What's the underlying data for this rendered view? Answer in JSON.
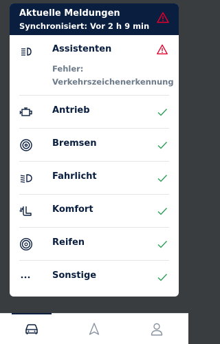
{
  "header": {
    "title": "Aktuelle Meldungen",
    "subtitle": "Synchronisiert: Vor 2 h 9 min",
    "warning_icon": "warning-triangle-icon"
  },
  "items": [
    {
      "label": "Assistenten",
      "icon": "driver-assist-icon",
      "status": "warning",
      "error": [
        "Fehler:",
        "Verkehrszeichenerkennung"
      ]
    },
    {
      "label": "Antrieb",
      "icon": "engine-icon",
      "status": "ok"
    },
    {
      "label": "Bremsen",
      "icon": "brake-icon",
      "status": "ok"
    },
    {
      "label": "Fahrlicht",
      "icon": "headlight-icon",
      "status": "ok"
    },
    {
      "label": "Komfort",
      "icon": "seat-heating-icon",
      "status": "ok"
    },
    {
      "label": "Reifen",
      "icon": "tire-icon",
      "status": "ok"
    },
    {
      "label": "Sonstige",
      "icon": "more-icon",
      "status": "ok"
    }
  ],
  "nav": [
    {
      "name": "car-tab",
      "icon": "car-icon",
      "active": true
    },
    {
      "name": "navigation-tab",
      "icon": "navigation-arrow-icon",
      "active": false
    },
    {
      "name": "profile-tab",
      "icon": "user-icon",
      "active": false
    }
  ],
  "colors": {
    "header_bg": "#0a1e3f",
    "warning": "#e4002b",
    "ok": "#2e9e5b",
    "text": "#0a1e3f",
    "muted": "#6c7a89"
  }
}
